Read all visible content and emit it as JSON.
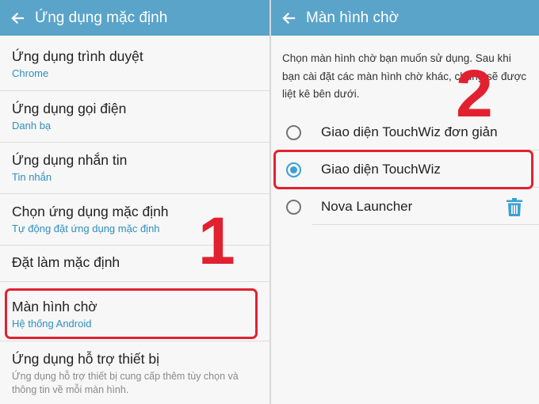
{
  "left": {
    "title": "Ứng dụng mặc định",
    "items": [
      {
        "title": "Ứng dụng trình duyệt",
        "subtitle": "Chrome"
      },
      {
        "title": "Ứng dụng gọi điện",
        "subtitle": "Danh bạ"
      },
      {
        "title": "Ứng dụng nhắn tin",
        "subtitle": "Tin nhắn"
      },
      {
        "title": "Chọn ứng dụng mặc định",
        "subtitle": "Tự động đặt ứng dụng mặc định"
      },
      {
        "title": "Đặt làm mặc định"
      },
      {
        "title": "Màn hình chờ",
        "subtitle": "Hệ thống Android"
      },
      {
        "title": "Ứng dụng hỗ trợ thiết bị",
        "description": "Ứng dụng hỗ trợ thiết bị cung cấp thêm tùy chọn và thông tin về mỗi màn hình."
      }
    ],
    "annotation": "1"
  },
  "right": {
    "title": "Màn hình chờ",
    "description": "Chọn màn hình chờ bạn muốn sử dụng. Sau khi bạn cài đặt các màn hình chờ khác, chúng sẽ được liệt kê bên dưới.",
    "options": [
      {
        "label": "Giao diện TouchWiz đơn giản",
        "selected": false
      },
      {
        "label": "Giao diện TouchWiz",
        "selected": true
      },
      {
        "label": "Nova Launcher",
        "selected": false
      }
    ],
    "annotation": "2"
  },
  "colors": {
    "appbar": "#5aa4c9",
    "accent": "#3aa0d8",
    "subtitle": "#2f8fc0",
    "highlight": "#e22130"
  },
  "icons": {
    "back": "arrow-left-icon",
    "delete": "trash-icon"
  }
}
